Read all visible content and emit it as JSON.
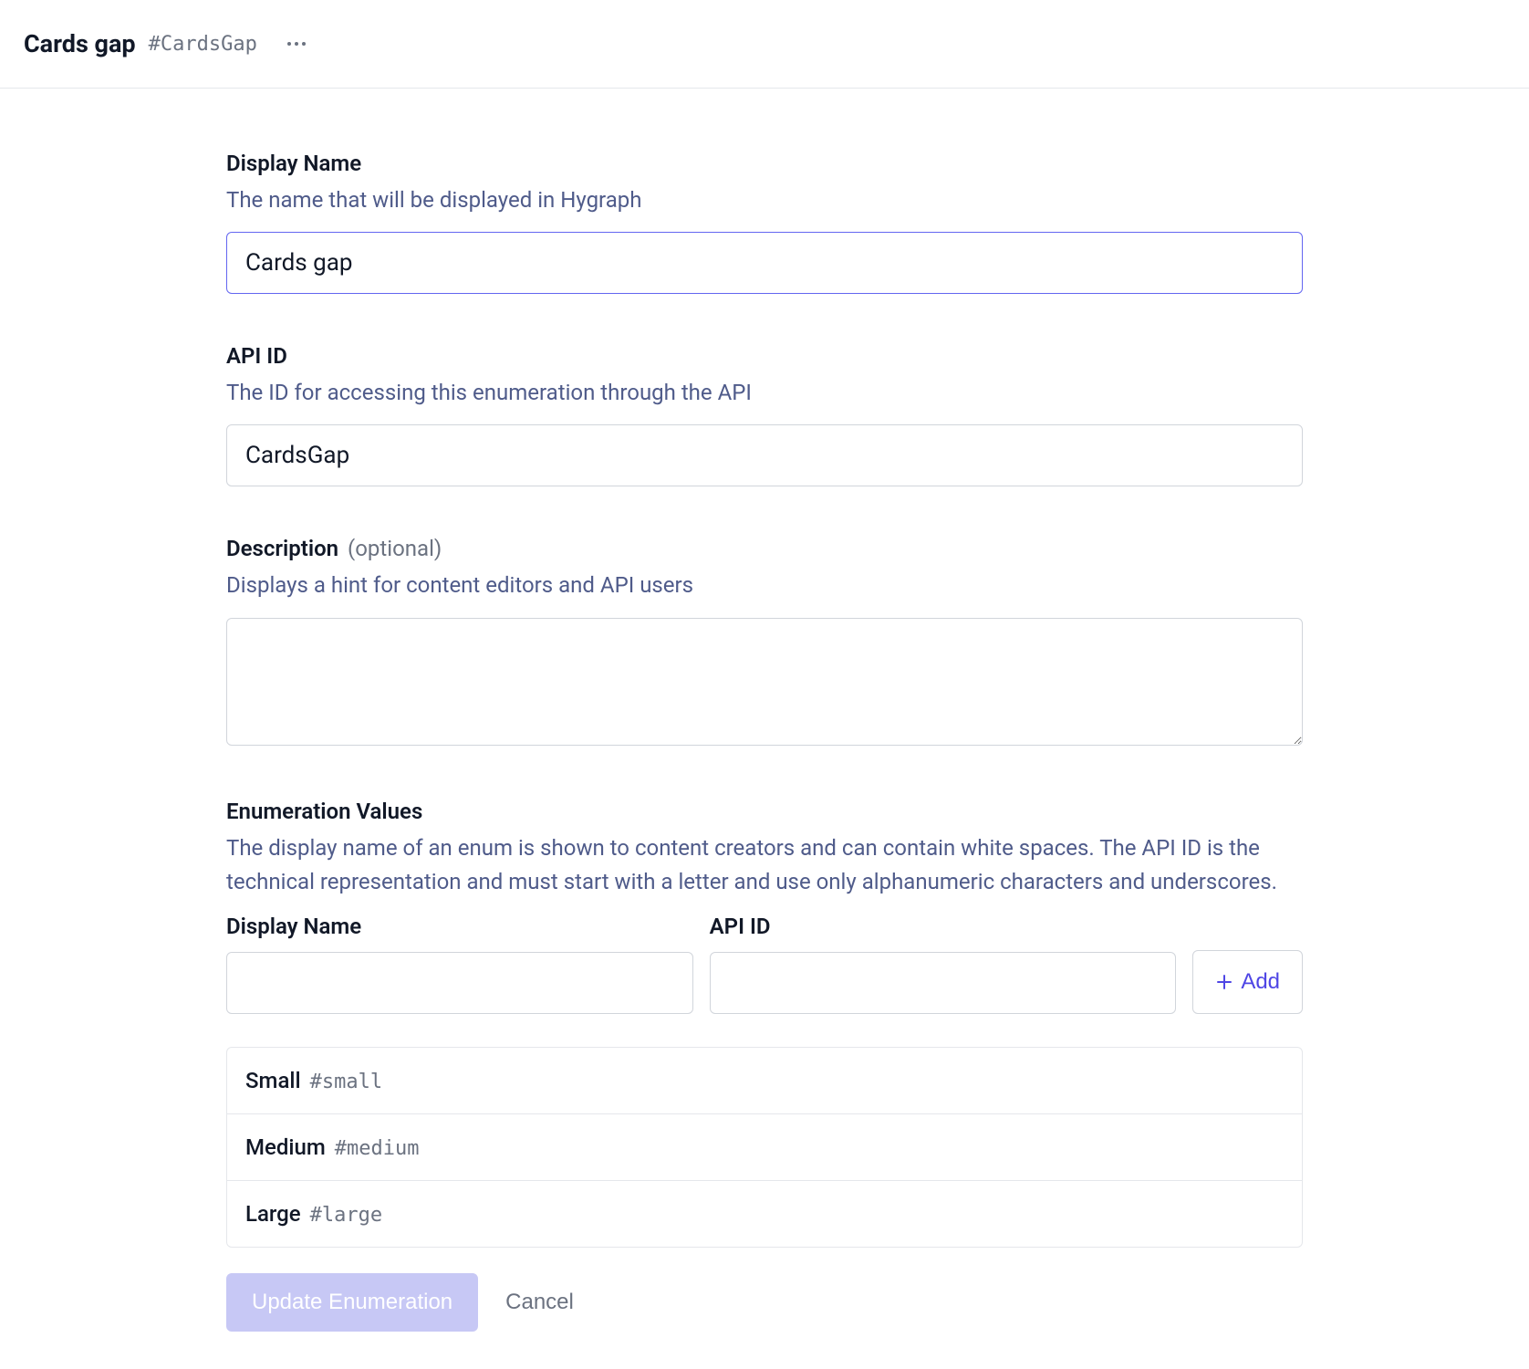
{
  "header": {
    "title": "Cards gap",
    "tag": "#CardsGap"
  },
  "fields": {
    "displayName": {
      "label": "Display Name",
      "hint": "The name that will be displayed in Hygraph",
      "value": "Cards gap"
    },
    "apiId": {
      "label": "API ID",
      "hint": "The ID for accessing this enumeration through the API",
      "value": "CardsGap"
    },
    "description": {
      "label": "Description",
      "optional": "(optional)",
      "hint": "Displays a hint for content editors and API users",
      "value": ""
    }
  },
  "enumSection": {
    "label": "Enumeration Values",
    "hint": "The display name of an enum is shown to content creators and can contain white spaces. The API ID is the technical representation and must start with a letter and use only alphanumeric characters and underscores.",
    "colDisplay": "Display Name",
    "colApi": "API ID",
    "addLabel": "Add",
    "items": [
      {
        "name": "Small",
        "tag": "#small"
      },
      {
        "name": "Medium",
        "tag": "#medium"
      },
      {
        "name": "Large",
        "tag": "#large"
      }
    ]
  },
  "actions": {
    "update": "Update Enumeration",
    "cancel": "Cancel"
  }
}
